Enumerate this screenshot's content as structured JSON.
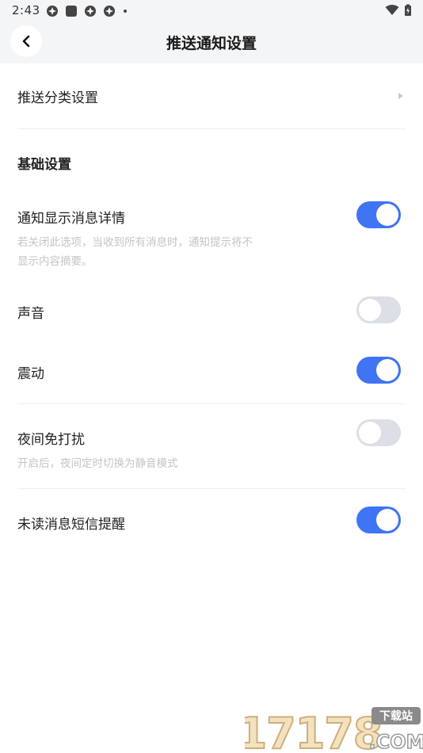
{
  "status_bar": {
    "time": "2:43"
  },
  "header": {
    "title": "推送通知设置"
  },
  "push_category": {
    "label": "推送分类设置"
  },
  "section": {
    "title": "基础设置"
  },
  "settings": [
    {
      "label": "通知显示消息详情",
      "description": "若关闭此选项，当收到所有消息时，通知提示将不显示内容摘要。",
      "enabled": true
    },
    {
      "label": "声音",
      "enabled": false
    },
    {
      "label": "震动",
      "enabled": true
    },
    {
      "label": "夜间免打扰",
      "description": "开启后，夜间定时切换为静音模式",
      "enabled": false
    },
    {
      "label": "未读消息短信提醒",
      "enabled": true
    }
  ],
  "watermark": {
    "text": "17178",
    "badge": "下载站",
    "domain": ".COM"
  },
  "colors": {
    "accent": "#3f74f3",
    "toggle_off": "#dcdfe6",
    "header_bg": "#f4f5f7"
  }
}
